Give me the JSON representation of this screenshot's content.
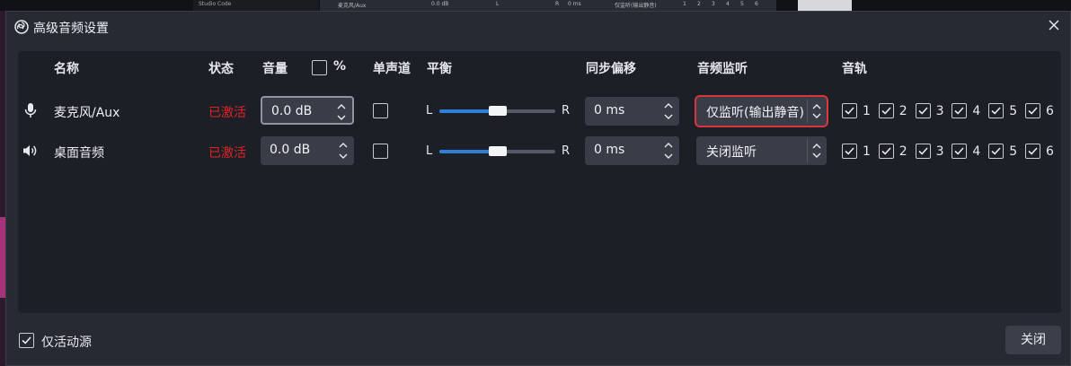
{
  "background": {
    "left_title": "Studio Code",
    "mirror_name": "麦克风/Aux",
    "mirror_volume": "0.0 dB",
    "mirror_l": "L",
    "mirror_r": "R",
    "mirror_sync": "0 ms",
    "mirror_monitor": "仅监听(输出静音)",
    "mirror_tracks": [
      "1",
      "2",
      "3",
      "4",
      "5",
      "6"
    ]
  },
  "dialog": {
    "title": "高级音频设置",
    "close_label": "关闭",
    "active_only_label": "仅活动源",
    "active_only_checked": true
  },
  "columns": {
    "name": "名称",
    "status": "状态",
    "volume": "音量",
    "percent": "%",
    "mono": "单声道",
    "balance": "平衡",
    "sync_offset": "同步偏移",
    "monitoring": "音频监听",
    "tracks": "音轨"
  },
  "rows": [
    {
      "icon": "microphone-icon",
      "name": "麦克风/Aux",
      "status": "已激活",
      "volume": "0.0 dB",
      "mono": false,
      "balance_left": "L",
      "balance_right": "R",
      "balance_value": 0.5,
      "sync": "0 ms",
      "monitoring": "仅监听(输出静音)",
      "tracks": [
        "1",
        "2",
        "3",
        "4",
        "5",
        "6"
      ]
    },
    {
      "icon": "speaker-icon",
      "name": "桌面音频",
      "status": "已激活",
      "volume": "0.0 dB",
      "mono": false,
      "balance_left": "L",
      "balance_right": "R",
      "balance_value": 0.5,
      "sync": "0 ms",
      "monitoring": "关闭监听",
      "tracks": [
        "1",
        "2",
        "3",
        "4",
        "5",
        "6"
      ]
    }
  ],
  "colors": {
    "active_status": "#e02424",
    "slider_fill": "#2f7fd8",
    "highlight_box": "#d9373b"
  }
}
